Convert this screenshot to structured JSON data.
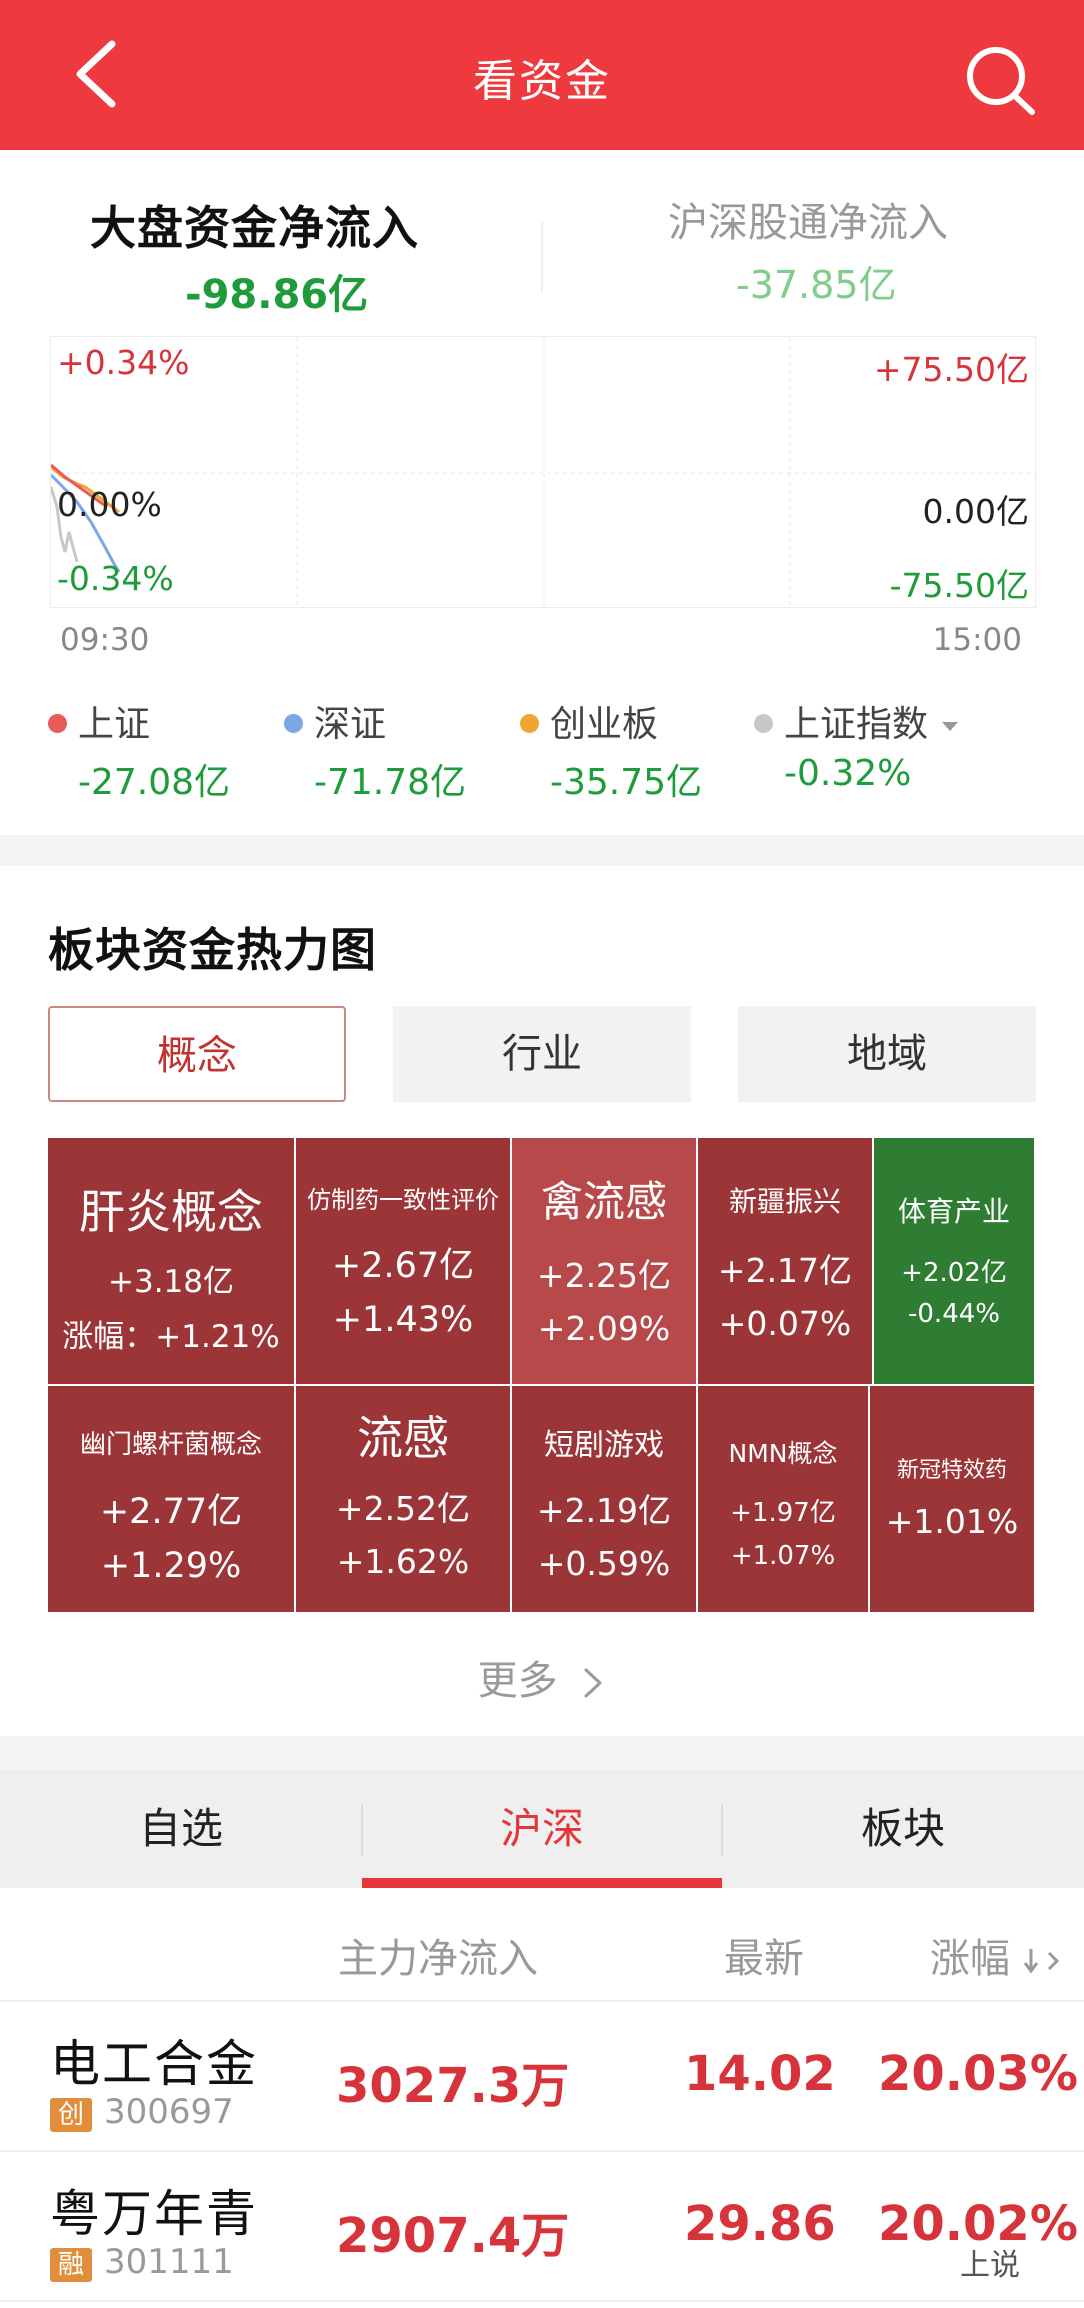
{
  "header": {
    "title": "看资金",
    "back_icon": "chevron-left-icon",
    "search_icon": "search-icon"
  },
  "flow": {
    "market_label": "大盘资金净流入",
    "market_value": "-98.86亿",
    "connect_label": "沪深股通净流入",
    "connect_value": "-37.85亿"
  },
  "intraday_chart": {
    "left_top": "+0.34%",
    "left_mid": "0.00%",
    "left_bottom": "-0.34%",
    "right_top": "+75.50亿",
    "right_mid": "0.00亿",
    "right_bottom": "-75.50亿",
    "time_start": "09:30",
    "time_end": "15:00"
  },
  "legend": [
    {
      "name": "上证",
      "value": "-27.08亿",
      "color": "#e95a5a"
    },
    {
      "name": "深证",
      "value": "-71.78亿",
      "color": "#7aa7e6"
    },
    {
      "name": "创业板",
      "value": "-35.75亿",
      "color": "#f0a532"
    },
    {
      "name": "上证指数",
      "value": "-0.32%",
      "color": "#c8c8c8"
    }
  ],
  "heatmap": {
    "title": "板块资金热力图",
    "tabs": [
      "概念",
      "行业",
      "地域"
    ],
    "cells": [
      {
        "name": "肝炎概念",
        "flow": "+3.18亿",
        "change": "涨幅：+1.21%",
        "color": "#9b3537"
      },
      {
        "name": "仿制药一致性评价",
        "flow": "+2.67亿",
        "change": "+1.43%",
        "color": "#9b3537"
      },
      {
        "name": "禽流感",
        "flow": "+2.25亿",
        "change": "+2.09%",
        "color": "#b8494b"
      },
      {
        "name": "新疆振兴",
        "flow": "+2.17亿",
        "change": "+0.07%",
        "color": "#9b3537"
      },
      {
        "name": "体育产业",
        "flow": "+2.02亿",
        "change": "-0.44%",
        "color": "#2e7d32"
      },
      {
        "name": "幽门螺杆菌概念",
        "flow": "+2.77亿",
        "change": "+1.29%",
        "color": "#9b3537"
      },
      {
        "name": "流感",
        "flow": "+2.52亿",
        "change": "+1.62%",
        "color": "#9b3537"
      },
      {
        "name": "短剧游戏",
        "flow": "+2.19亿",
        "change": "+0.59%",
        "color": "#9b3537"
      },
      {
        "name": "NMN概念",
        "flow": "+1.97亿",
        "change": "+1.07%",
        "color": "#9b3537"
      },
      {
        "name": "新冠特效药",
        "flow": "+1.01%",
        "change": "",
        "color": "#9b3537"
      }
    ],
    "more": "更多"
  },
  "market_tabs": [
    "自选",
    "沪深",
    "板块"
  ],
  "table": {
    "headers": {
      "flow": "主力净流入",
      "latest": "最新",
      "change": "涨幅"
    },
    "rows": [
      {
        "name": "电工合金",
        "badge": "创",
        "code": "300697",
        "flow": "3027.3万",
        "latest": "14.02",
        "change": "20.03%"
      },
      {
        "name": "粤万年青",
        "badge": "融",
        "code": "301111",
        "flow": "2907.4万",
        "latest": "29.86",
        "change": "20.02%"
      }
    ]
  },
  "watermark": "上说"
}
